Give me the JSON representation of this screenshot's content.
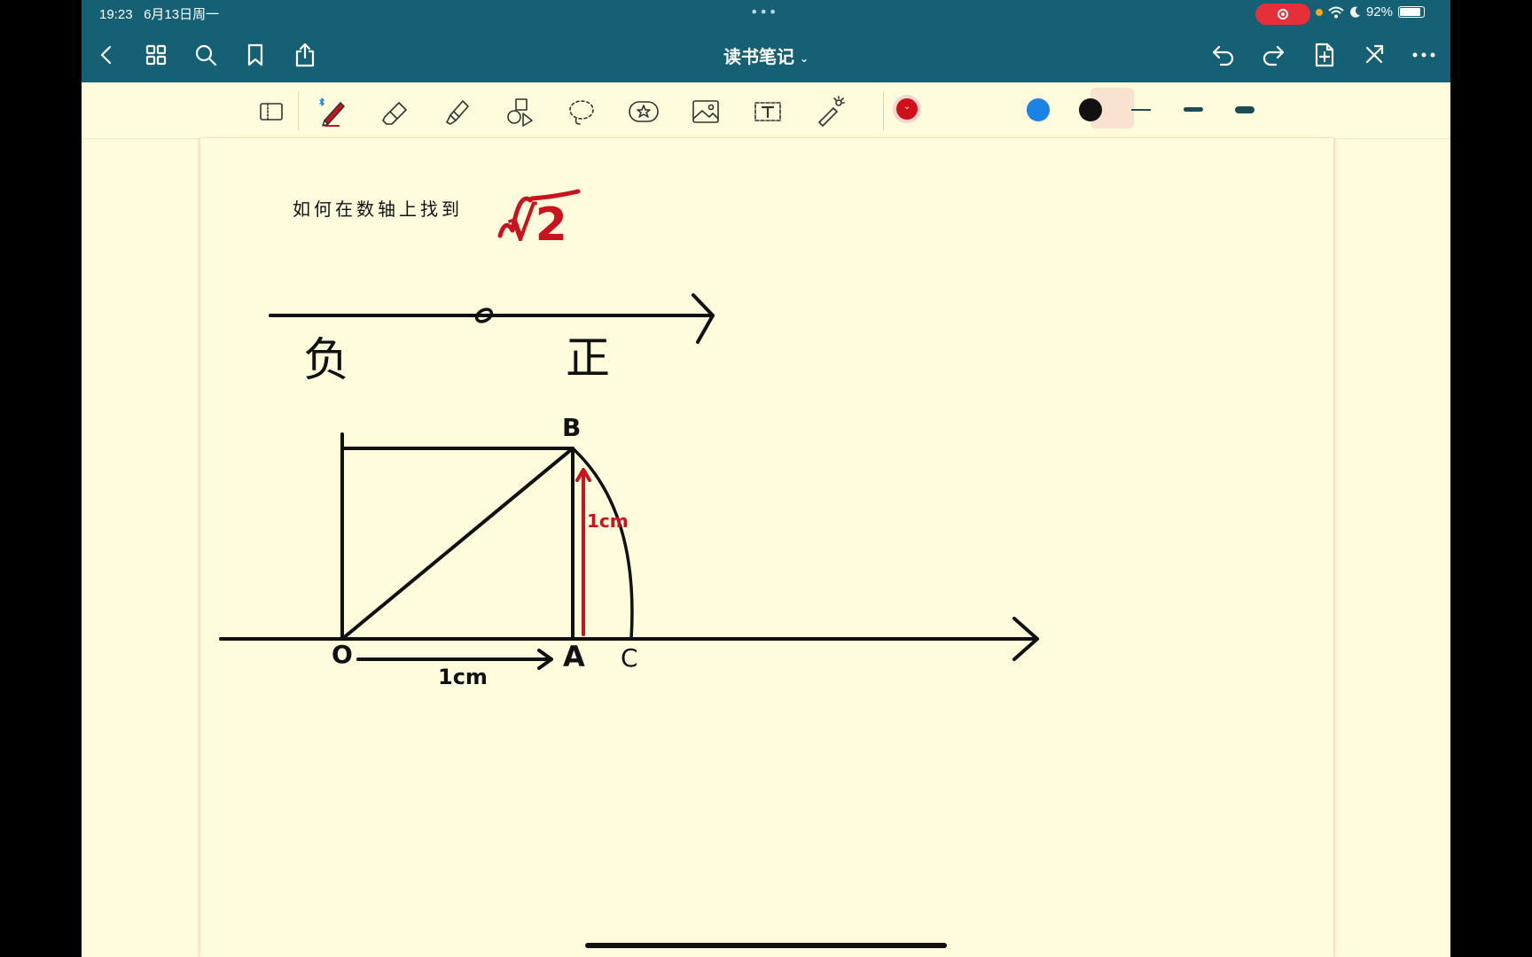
{
  "status_bar": {
    "time": "19:23",
    "date": "6月13日周一",
    "battery": "92%",
    "battery_level": 0.92,
    "center_dots": "•••"
  },
  "nav": {
    "title": "读书笔记",
    "left_icons": [
      "back-icon",
      "grid-icon",
      "search-icon",
      "bookmark-icon",
      "share-icon"
    ],
    "right_icons": [
      "undo-icon",
      "redo-icon",
      "add-page-icon",
      "close-icon",
      "more-icon"
    ]
  },
  "toolbar": {
    "tools": [
      "page-view-icon",
      "pen-icon",
      "eraser-icon",
      "highlighter-icon",
      "shapes-icon",
      "lasso-icon",
      "sticker-icon",
      "image-icon",
      "text-icon",
      "laser-pointer-icon"
    ],
    "active_tool": "pen-icon",
    "colors": [
      "#d10f1b",
      "#1b82e6",
      "#111111"
    ],
    "selected_color": "#d10f1b",
    "stroke_widths": [
      "thin",
      "medium",
      "thick"
    ],
    "selected_stroke": "medium"
  },
  "note": {
    "heading": "如何在数轴上找到",
    "sqrt_label": "√2",
    "negative_label": "负",
    "positive_label": "正",
    "origin_label": "0",
    "point_o": "O",
    "point_a": "A",
    "point_b": "B",
    "point_c": "C",
    "measure_oa": "1cm",
    "measure_ab": "1cm",
    "ink_colors": {
      "black": "#111111",
      "red": "#c8141e"
    }
  }
}
